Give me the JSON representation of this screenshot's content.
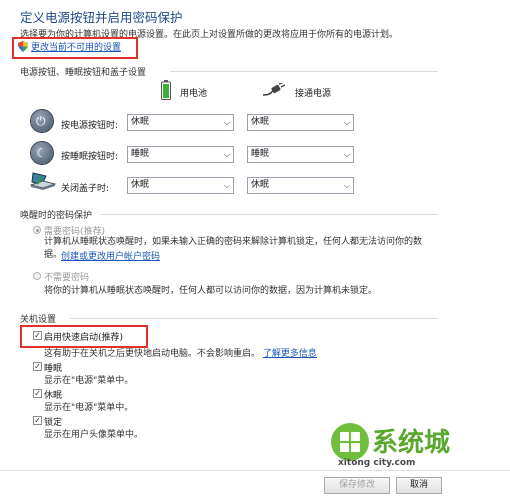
{
  "header": {
    "title": "定义电源按钮并启用密码保护",
    "subtitle": "选择要为你的计算机设置的电源设置。在此页上对设置所做的更改将应用于你所有的电源计划。",
    "change_unavailable_link": "更改当前不可用的设置"
  },
  "power_buttons": {
    "section_title": "电源按钮、睡眠按钮和盖子设置",
    "col_battery": "用电池",
    "col_plugged": "接通电源",
    "rows": [
      {
        "label": "按电源按钮时:",
        "battery": "休眠",
        "plugged": "休眠",
        "icon": "power-button-icon"
      },
      {
        "label": "按睡眠按钮时:",
        "battery": "睡眠",
        "plugged": "睡眠",
        "icon": "sleep-button-icon"
      },
      {
        "label": "关闭盖子时:",
        "battery": "休眠",
        "plugged": "休眠",
        "icon": "laptop-lid-icon"
      }
    ]
  },
  "wake_password": {
    "section_title": "唤醒时的密码保护",
    "require_label": "需要密码(推荐)",
    "require_desc": "计算机从睡眠状态唤醒时，如果未输入正确的密码来解除计算机锁定，任何人都无法访问你的数据。",
    "create_link": "创建或更改用户帐户密码",
    "no_require_label": "不需要密码",
    "no_require_desc": "将你的计算机从睡眠状态唤醒时，任何人都可以访问你的数据，因为计算机未锁定。"
  },
  "shutdown": {
    "section_title": "关机设置",
    "fast_startup_label": "启用快速启动(推荐)",
    "fast_startup_desc": "这有助于在关机之后更快地启动电脑。不会影响重启。",
    "learn_more": "了解更多信息",
    "items": [
      {
        "label": "睡眠",
        "desc": "显示在\"电源\"菜单中。"
      },
      {
        "label": "休眠",
        "desc": "显示在\"电源\"菜单中。"
      },
      {
        "label": "锁定",
        "desc": "显示在用户头像菜单中。"
      }
    ]
  },
  "watermark": {
    "brand": "系统城",
    "url": "xitong city.com"
  },
  "buttons": {
    "save": "保存修改",
    "cancel": "取消"
  }
}
